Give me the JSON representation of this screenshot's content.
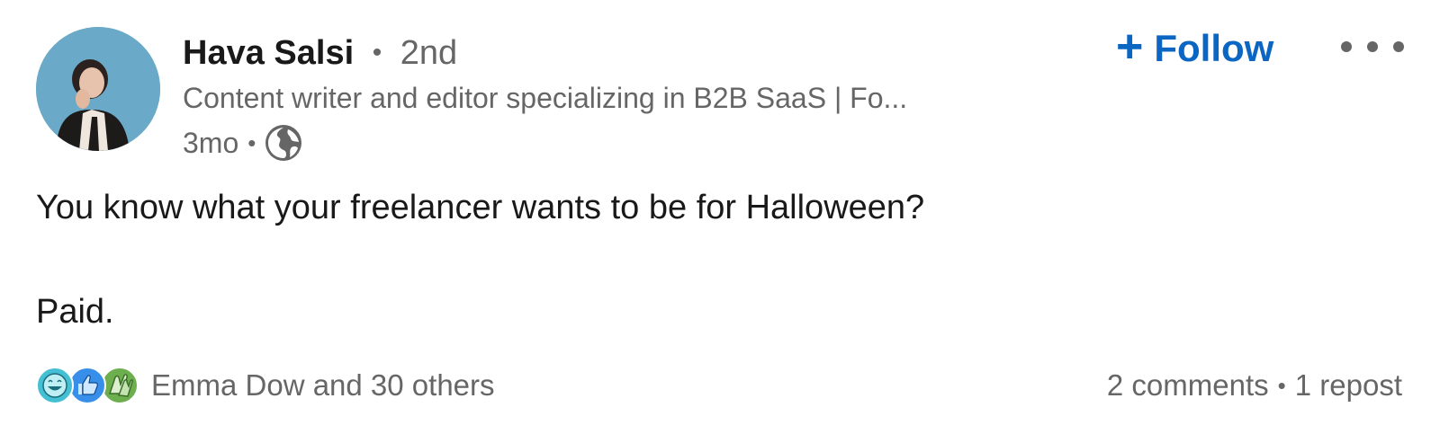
{
  "post": {
    "author": {
      "name": "Hava Salsi",
      "separator": "•",
      "degree": "2nd",
      "headline": "Content writer and editor specializing in B2B SaaS | Fo...",
      "time": "3mo",
      "visibility_icon": "globe-icon"
    },
    "follow_label": "Follow",
    "follow_icon": "plus-icon",
    "more_icon": "more-options-icon",
    "text_line1": "You know what your freelancer wants to be for Halloween?",
    "text_line2": "Paid.",
    "reactions": {
      "icons": [
        "funny-reaction-icon",
        "like-reaction-icon",
        "celebrate-reaction-icon"
      ],
      "summary": "Emma Dow and 30 others"
    },
    "comments": "2 comments",
    "reposts": "1 repost",
    "dot": "•"
  },
  "colors": {
    "accent": "#0a66c2",
    "secondary_text": "#666666",
    "primary_text": "#191919",
    "avatar_bg": "#6aa9c7"
  }
}
